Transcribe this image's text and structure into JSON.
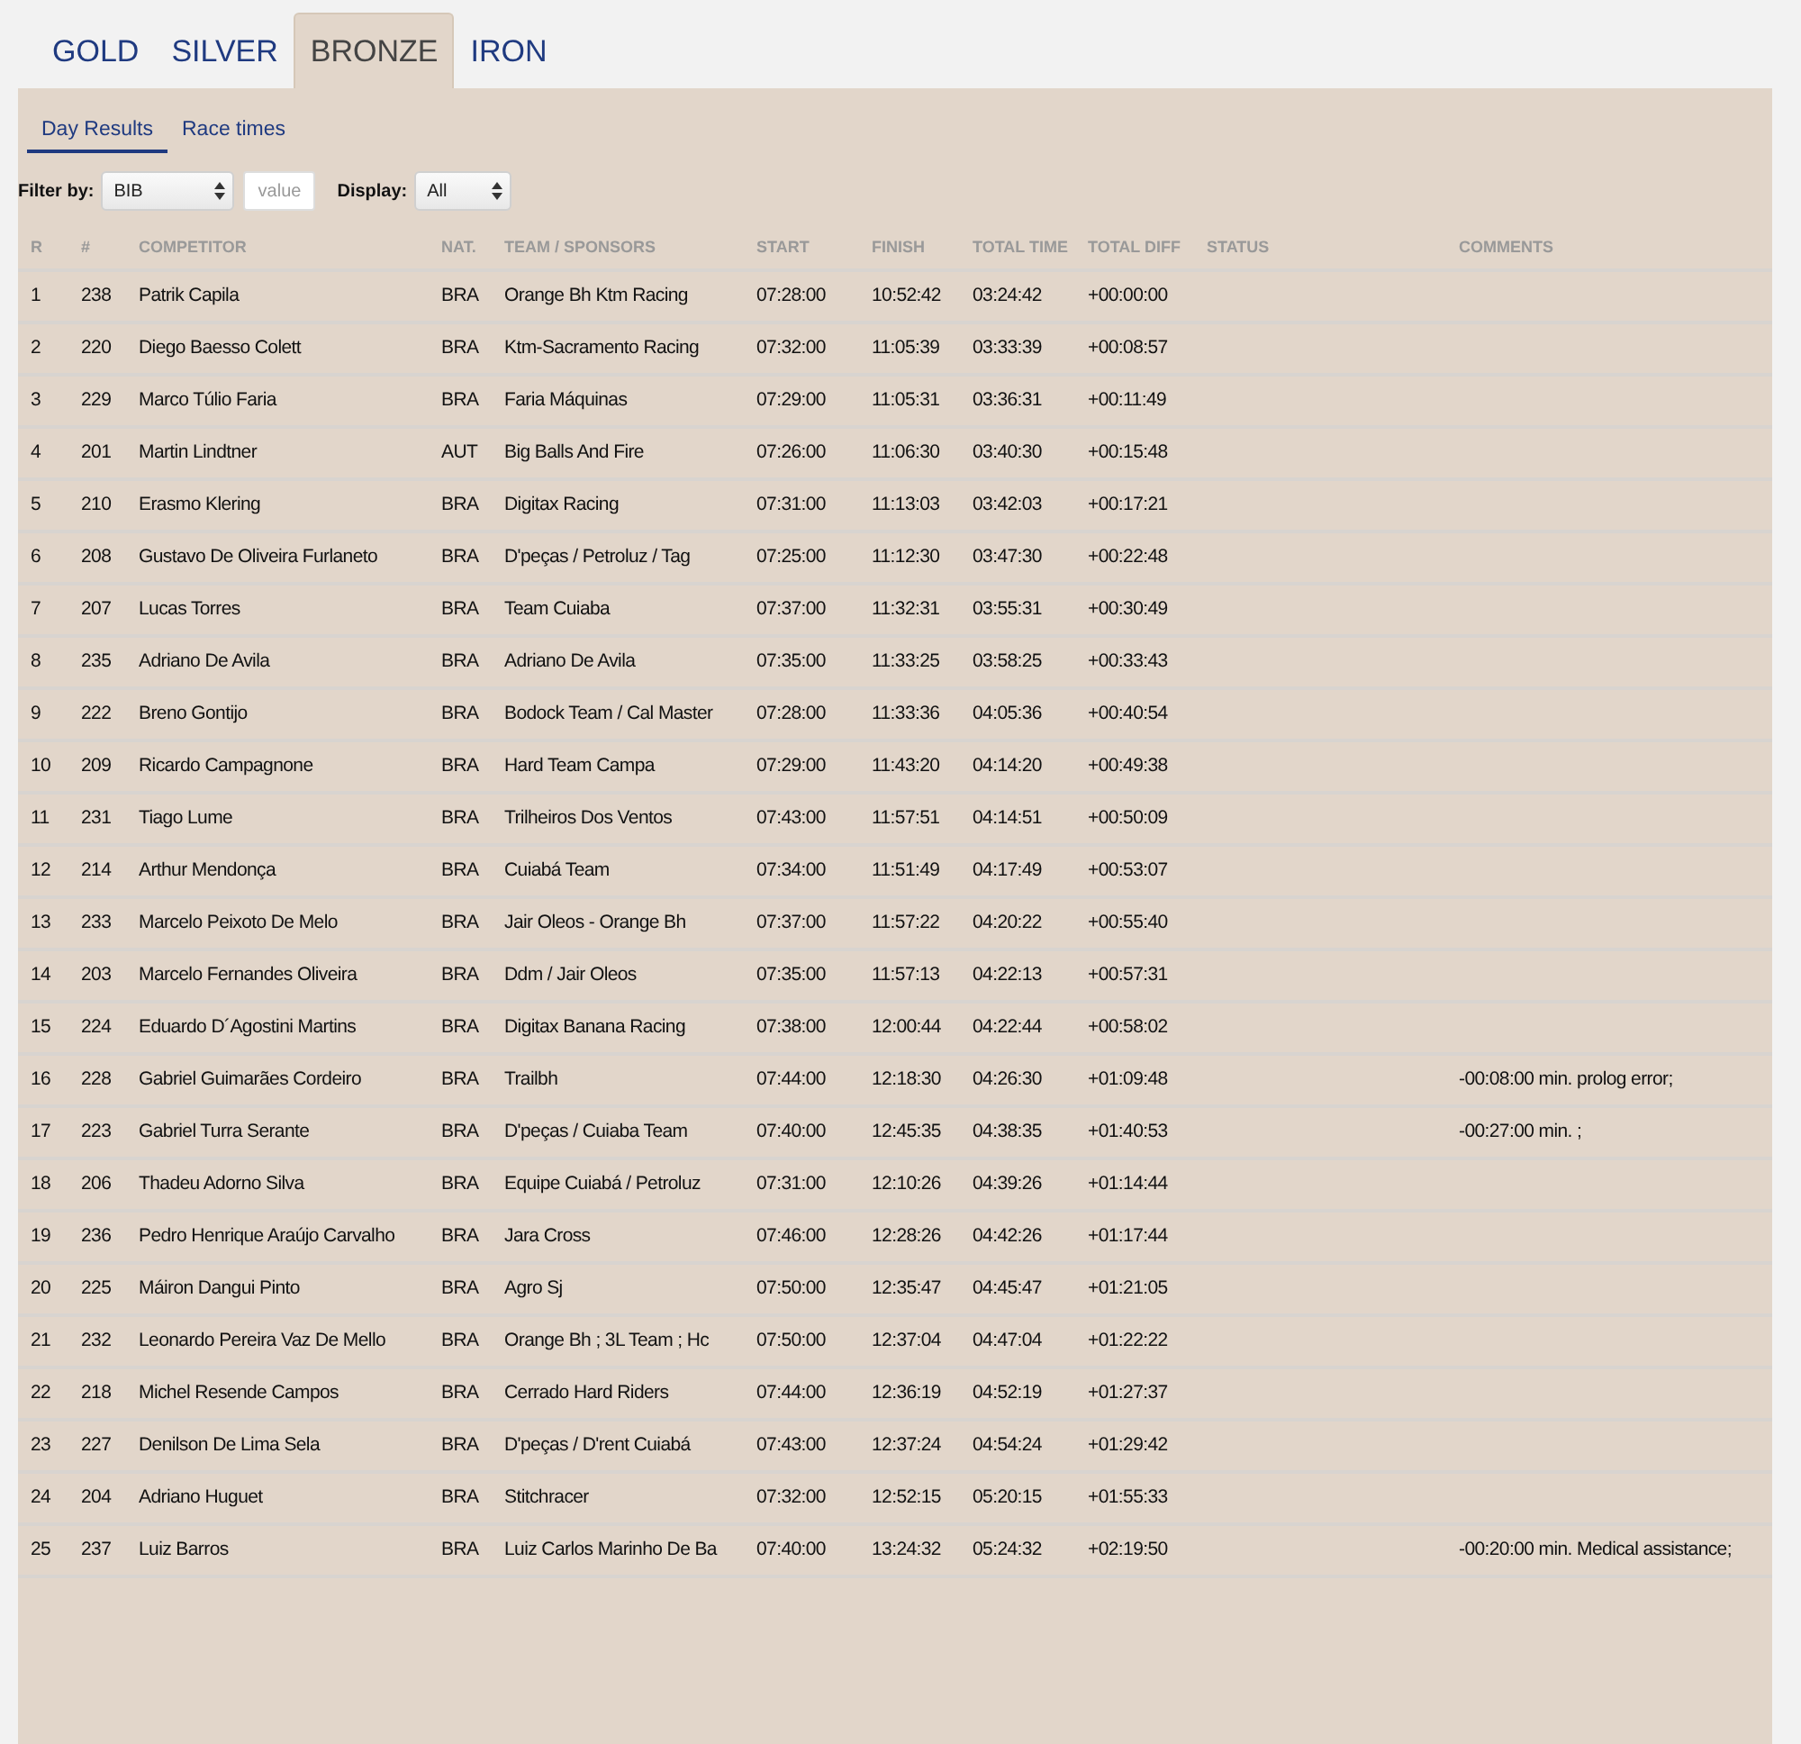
{
  "tabs": [
    {
      "label": "GOLD",
      "selected": false
    },
    {
      "label": "SILVER",
      "selected": false
    },
    {
      "label": "BRONZE",
      "selected": true
    },
    {
      "label": "IRON",
      "selected": false
    }
  ],
  "subtabs": [
    {
      "label": "Day Results",
      "selected": true
    },
    {
      "label": "Race times",
      "selected": false
    }
  ],
  "filters": {
    "filter_label": "Filter by:",
    "filter_select": {
      "value": "BIB"
    },
    "value_field": {
      "placeholder": "value"
    },
    "display_label": "Display:",
    "display_select": {
      "value": "All"
    }
  },
  "table": {
    "columns": [
      "R",
      "#",
      "COMPETITOR",
      "NAT.",
      "TEAM / SPONSORS",
      "START",
      "FINISH",
      "TOTAL TIME",
      "TOTAL DIFF",
      "STATUS",
      "COMMENTS"
    ],
    "rows": [
      {
        "rank": "1",
        "bib": "238",
        "competitor": "Patrik Capila",
        "nat": "BRA",
        "team": "Orange Bh Ktm Racing",
        "start": "07:28:00",
        "finish": "10:52:42",
        "total_time": "03:24:42",
        "total_diff": "+00:00:00"
      },
      {
        "rank": "2",
        "bib": "220",
        "competitor": "Diego Baesso Colett",
        "nat": "BRA",
        "team": "Ktm-Sacramento Racing",
        "start": "07:32:00",
        "finish": "11:05:39",
        "total_time": "03:33:39",
        "total_diff": "+00:08:57"
      },
      {
        "rank": "3",
        "bib": "229",
        "competitor": "Marco Túlio Faria",
        "nat": "BRA",
        "team": "Faria Máquinas",
        "start": "07:29:00",
        "finish": "11:05:31",
        "total_time": "03:36:31",
        "total_diff": "+00:11:49"
      },
      {
        "rank": "4",
        "bib": "201",
        "competitor": "Martin Lindtner",
        "nat": "AUT",
        "team": "Big Balls And Fire",
        "start": "07:26:00",
        "finish": "11:06:30",
        "total_time": "03:40:30",
        "total_diff": "+00:15:48"
      },
      {
        "rank": "5",
        "bib": "210",
        "competitor": "Erasmo Klering",
        "nat": "BRA",
        "team": "Digitax Racing",
        "start": "07:31:00",
        "finish": "11:13:03",
        "total_time": "03:42:03",
        "total_diff": "+00:17:21"
      },
      {
        "rank": "6",
        "bib": "208",
        "competitor": "Gustavo De Oliveira Furlaneto",
        "nat": "BRA",
        "team": "D'peças / Petroluz / Tag",
        "start": "07:25:00",
        "finish": "11:12:30",
        "total_time": "03:47:30",
        "total_diff": "+00:22:48"
      },
      {
        "rank": "7",
        "bib": "207",
        "competitor": "Lucas Torres",
        "nat": "BRA",
        "team": "Team Cuiaba",
        "start": "07:37:00",
        "finish": "11:32:31",
        "total_time": "03:55:31",
        "total_diff": "+00:30:49"
      },
      {
        "rank": "8",
        "bib": "235",
        "competitor": "Adriano De Avila",
        "nat": "BRA",
        "team": "Adriano De Avila",
        "start": "07:35:00",
        "finish": "11:33:25",
        "total_time": "03:58:25",
        "total_diff": "+00:33:43"
      },
      {
        "rank": "9",
        "bib": "222",
        "competitor": "Breno Gontijo",
        "nat": "BRA",
        "team": "Bodock Team / Cal Master",
        "start": "07:28:00",
        "finish": "11:33:36",
        "total_time": "04:05:36",
        "total_diff": "+00:40:54"
      },
      {
        "rank": "10",
        "bib": "209",
        "competitor": "Ricardo Campagnone",
        "nat": "BRA",
        "team": "Hard Team Campa",
        "start": "07:29:00",
        "finish": "11:43:20",
        "total_time": "04:14:20",
        "total_diff": "+00:49:38"
      },
      {
        "rank": "11",
        "bib": "231",
        "competitor": "Tiago Lume",
        "nat": "BRA",
        "team": "Trilheiros Dos Ventos",
        "start": "07:43:00",
        "finish": "11:57:51",
        "total_time": "04:14:51",
        "total_diff": "+00:50:09"
      },
      {
        "rank": "12",
        "bib": "214",
        "competitor": "Arthur Mendonça",
        "nat": "BRA",
        "team": "Cuiabá Team",
        "start": "07:34:00",
        "finish": "11:51:49",
        "total_time": "04:17:49",
        "total_diff": "+00:53:07"
      },
      {
        "rank": "13",
        "bib": "233",
        "competitor": "Marcelo Peixoto De Melo",
        "nat": "BRA",
        "team": "Jair Oleos - Orange Bh",
        "start": "07:37:00",
        "finish": "11:57:22",
        "total_time": "04:20:22",
        "total_diff": "+00:55:40"
      },
      {
        "rank": "14",
        "bib": "203",
        "competitor": "Marcelo Fernandes Oliveira",
        "nat": "BRA",
        "team": "Ddm / Jair Oleos",
        "start": "07:35:00",
        "finish": "11:57:13",
        "total_time": "04:22:13",
        "total_diff": "+00:57:31"
      },
      {
        "rank": "15",
        "bib": "224",
        "competitor": "Eduardo D´Agostini Martins",
        "nat": "BRA",
        "team": "Digitax Banana Racing",
        "start": "07:38:00",
        "finish": "12:00:44",
        "total_time": "04:22:44",
        "total_diff": "+00:58:02"
      },
      {
        "rank": "16",
        "bib": "228",
        "competitor": "Gabriel Guimarães Cordeiro",
        "nat": "BRA",
        "team": "Trailbh",
        "start": "07:44:00",
        "finish": "12:18:30",
        "total_time": "04:26:30",
        "total_diff": "+01:09:48",
        "comments": "-00:08:00 min. prolog error;"
      },
      {
        "rank": "17",
        "bib": "223",
        "competitor": "Gabriel Turra Serante",
        "nat": "BRA",
        "team": "D'peças / Cuiaba Team",
        "start": "07:40:00",
        "finish": "12:45:35",
        "total_time": "04:38:35",
        "total_diff": "+01:40:53",
        "comments": "-00:27:00 min. ;"
      },
      {
        "rank": "18",
        "bib": "206",
        "competitor": "Thadeu Adorno Silva",
        "nat": "BRA",
        "team": "Equipe Cuiabá / Petroluz",
        "start": "07:31:00",
        "finish": "12:10:26",
        "total_time": "04:39:26",
        "total_diff": "+01:14:44"
      },
      {
        "rank": "19",
        "bib": "236",
        "competitor": "Pedro Henrique Araújo Carvalho",
        "nat": "BRA",
        "team": "Jara Cross",
        "start": "07:46:00",
        "finish": "12:28:26",
        "total_time": "04:42:26",
        "total_diff": "+01:17:44"
      },
      {
        "rank": "20",
        "bib": "225",
        "competitor": "Máiron Dangui Pinto",
        "nat": "BRA",
        "team": "Agro Sj",
        "start": "07:50:00",
        "finish": "12:35:47",
        "total_time": "04:45:47",
        "total_diff": "+01:21:05"
      },
      {
        "rank": "21",
        "bib": "232",
        "competitor": "Leonardo Pereira Vaz De Mello",
        "nat": "BRA",
        "team": "Orange Bh ; 3L Team ; Hc",
        "start": "07:50:00",
        "finish": "12:37:04",
        "total_time": "04:47:04",
        "total_diff": "+01:22:22"
      },
      {
        "rank": "22",
        "bib": "218",
        "competitor": "Michel Resende Campos",
        "nat": "BRA",
        "team": "Cerrado Hard Riders",
        "start": "07:44:00",
        "finish": "12:36:19",
        "total_time": "04:52:19",
        "total_diff": "+01:27:37"
      },
      {
        "rank": "23",
        "bib": "227",
        "competitor": "Denilson De Lima Sela",
        "nat": "BRA",
        "team": "D'peças / D'rent Cuiabá",
        "start": "07:43:00",
        "finish": "12:37:24",
        "total_time": "04:54:24",
        "total_diff": "+01:29:42"
      },
      {
        "rank": "24",
        "bib": "204",
        "competitor": "Adriano Huguet",
        "nat": "BRA",
        "team": "Stitchracer",
        "start": "07:32:00",
        "finish": "12:52:15",
        "total_time": "05:20:15",
        "total_diff": "+01:55:33"
      },
      {
        "rank": "25",
        "bib": "237",
        "competitor": "Luiz Barros",
        "nat": "BRA",
        "team": "Luiz Carlos Marinho De Ba",
        "start": "07:40:00",
        "finish": "13:24:32",
        "total_time": "05:24:32",
        "total_diff": "+02:19:50",
        "comments": "-00:20:00 min. Medical assistance;"
      }
    ]
  }
}
